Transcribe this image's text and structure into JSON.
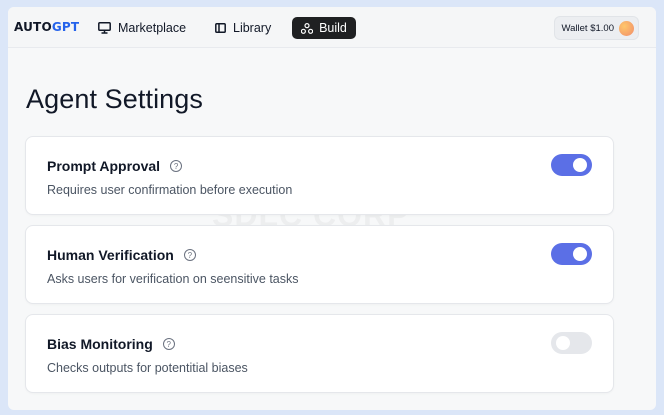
{
  "brand": {
    "part1": "AUTO",
    "part2": "GPT"
  },
  "nav": {
    "marketplace": "Marketplace",
    "library": "Library",
    "build": "Build"
  },
  "wallet": {
    "label": "Wallet $1.00"
  },
  "page": {
    "title": "Agent Settings"
  },
  "watermark": "SDLC CORP",
  "settings": [
    {
      "title": "Prompt Approval",
      "description": "Requires user confirmation before execution",
      "enabled": true
    },
    {
      "title": "Human Verification",
      "description": "Asks users for verification on seensitive tasks",
      "enabled": true
    },
    {
      "title": "Bias Monitoring",
      "description": "Checks outputs for potentitial biases",
      "enabled": false
    }
  ],
  "colors": {
    "toggle_on": "#5b6fe6",
    "toggle_off": "#e5e7eb",
    "build_button": "#1f2022",
    "brand_accent": "#2563eb"
  },
  "icons": {
    "marketplace": "monitor-icon",
    "library": "library-icon",
    "build": "build-icon",
    "help": "help-circle-icon"
  }
}
